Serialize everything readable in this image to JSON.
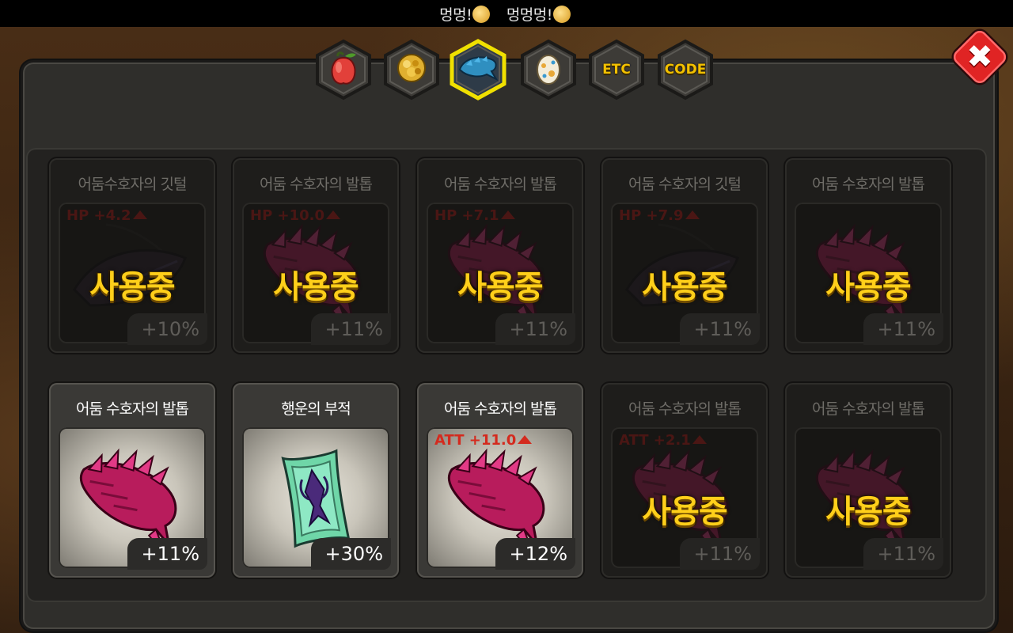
{
  "status_message": {
    "part1": "멍멍!",
    "part2": "멍멍멍!"
  },
  "tabs": [
    {
      "name": "fruit",
      "label": "",
      "icon": "fruit-icon",
      "selected": false
    },
    {
      "name": "gold",
      "label": "",
      "icon": "gold-coin-icon",
      "selected": false
    },
    {
      "name": "claw",
      "label": "",
      "icon": "claw-icon",
      "selected": true
    },
    {
      "name": "egg",
      "label": "",
      "icon": "egg-icon",
      "selected": false
    },
    {
      "name": "etc",
      "label": "ETC",
      "icon": "",
      "selected": false
    },
    {
      "name": "code",
      "label": "CODE",
      "icon": "",
      "selected": false
    }
  ],
  "close_label": "✖",
  "in_use_label": "사용중",
  "items": [
    {
      "name": "어둠수호자의 깃털",
      "stat": "HP +4.2",
      "bonus": "+10%",
      "in_use": true,
      "art": "feather"
    },
    {
      "name": "어둠 수호자의 발톱",
      "stat": "HP +10.0",
      "bonus": "+11%",
      "in_use": true,
      "art": "claw"
    },
    {
      "name": "어둠 수호자의 발톱",
      "stat": "HP +7.1",
      "bonus": "+11%",
      "in_use": true,
      "art": "claw"
    },
    {
      "name": "어둠 수호자의 깃털",
      "stat": "HP +7.9",
      "bonus": "+11%",
      "in_use": true,
      "art": "feather"
    },
    {
      "name": "어둠 수호자의 발톱",
      "stat": "",
      "bonus": "+11%",
      "in_use": true,
      "art": "claw"
    },
    {
      "name": "어둠 수호자의 발톱",
      "stat": "",
      "bonus": "+11%",
      "in_use": false,
      "art": "claw"
    },
    {
      "name": "행운의 부적",
      "stat": "",
      "bonus": "+30%",
      "in_use": false,
      "art": "talisman"
    },
    {
      "name": "어둠 수호자의 발톱",
      "stat": "ATT +11.0",
      "bonus": "+12%",
      "in_use": false,
      "art": "claw"
    },
    {
      "name": "어둠 수호자의 발톱",
      "stat": "ATT +2.1",
      "bonus": "+11%",
      "in_use": true,
      "art": "claw"
    },
    {
      "name": "어둠 수호자의 발톱",
      "stat": "",
      "bonus": "+11%",
      "in_use": true,
      "art": "claw"
    }
  ],
  "colors": {
    "in_use_text": "#ffcf1a",
    "stat_text": "#d42a1e",
    "tab_highlight": "#f0e000",
    "close_button": "#e02424",
    "claw": "#d8286e"
  }
}
